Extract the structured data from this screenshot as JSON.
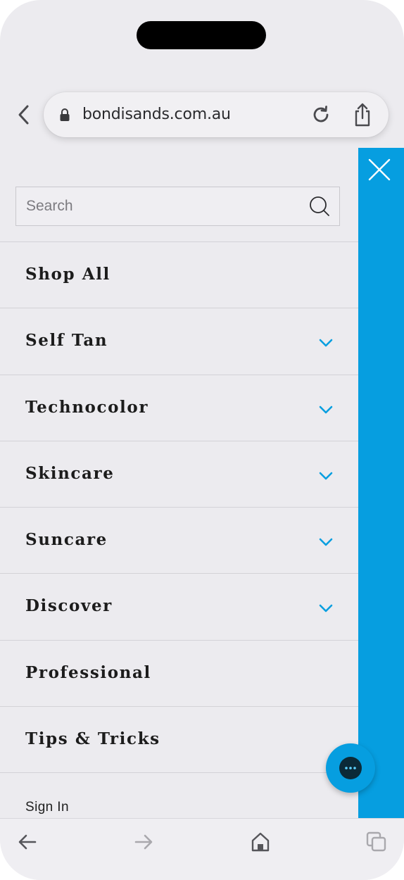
{
  "browser": {
    "url": "bondisands.com.au"
  },
  "search": {
    "placeholder": "Search"
  },
  "menu": {
    "items": [
      {
        "label": "Shop All",
        "has_chevron": false
      },
      {
        "label": "Self Tan",
        "has_chevron": true
      },
      {
        "label": "Technocolor",
        "has_chevron": true
      },
      {
        "label": "Skincare",
        "has_chevron": true
      },
      {
        "label": "Suncare",
        "has_chevron": true
      },
      {
        "label": "Discover",
        "has_chevron": true
      },
      {
        "label": "Professional",
        "has_chevron": false
      },
      {
        "label": "Tips & Tricks",
        "has_chevron": false
      }
    ],
    "sign_in": "Sign In"
  },
  "colors": {
    "accent": "#069ee0",
    "background": "#ecebef",
    "text": "#1c1c1c"
  },
  "icons": {
    "top_back": "chevron-left-icon",
    "lock": "lock-icon",
    "reload": "reload-icon",
    "share": "share-icon",
    "search": "search-icon",
    "close": "close-icon",
    "chat": "chat-icon",
    "toolbar_back": "arrow-left-icon",
    "toolbar_forward": "arrow-right-icon",
    "toolbar_home": "home-icon",
    "toolbar_tabs": "tabs-icon"
  }
}
